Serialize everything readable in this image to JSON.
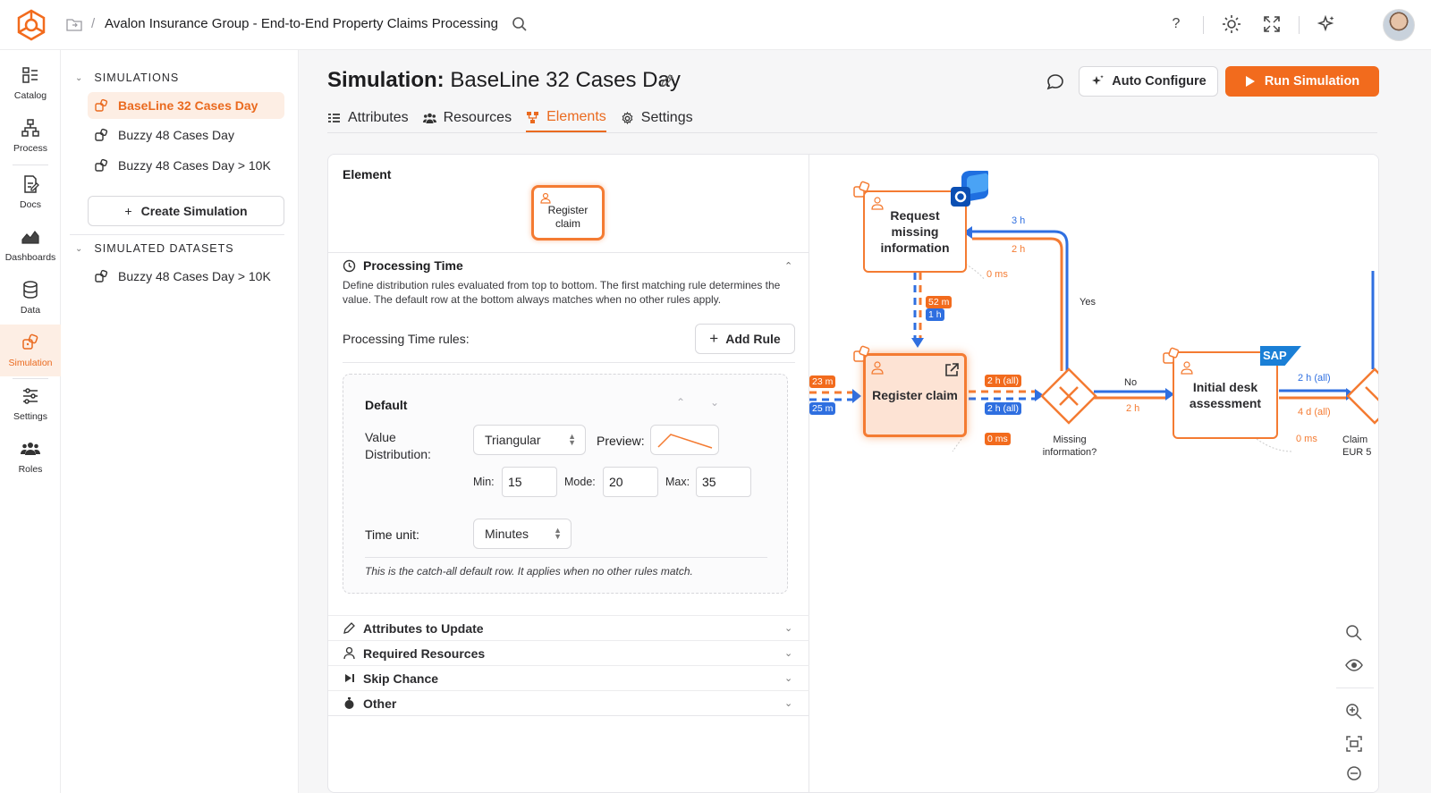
{
  "header": {
    "breadcrumb_sep": "/",
    "title": "Avalon Insurance Group - End-to-End Property Claims Processing",
    "help_glyph": "?"
  },
  "nav": [
    {
      "label": "Catalog",
      "icon": "catalog-icon"
    },
    {
      "label": "Process",
      "icon": "process-icon"
    },
    {
      "label": "Docs",
      "icon": "docs-icon"
    },
    {
      "label": "Dashboards",
      "icon": "dashboards-icon"
    },
    {
      "label": "Data",
      "icon": "data-icon"
    },
    {
      "label": "Simulation",
      "icon": "simulation-icon"
    },
    {
      "label": "Settings",
      "icon": "settings-icon"
    },
    {
      "label": "Roles",
      "icon": "roles-icon"
    }
  ],
  "simulations": {
    "heading": "SIMULATIONS",
    "items": [
      "BaseLine 32 Cases Day",
      "Buzzy 48 Cases Day",
      "Buzzy 48 Cases Day > 10K"
    ],
    "create_label": "Create Simulation",
    "datasets_heading": "SIMULATED DATASETS",
    "datasets": [
      "Buzzy 48 Cases Day > 10K"
    ]
  },
  "main": {
    "title_prefix": "Simulation:",
    "title_name": "BaseLine 32 Cases Day",
    "tabs": [
      "Attributes",
      "Resources",
      "Elements",
      "Settings"
    ],
    "auto_configure": "Auto Configure",
    "run_simulation": "Run Simulation"
  },
  "element": {
    "label": "Element",
    "node_name": "Register claim",
    "processing_time": "Processing Time",
    "description": "Define distribution rules evaluated from top to bottom. The first matching rule determines the value. The default row at the bottom always matches when no other rules apply.",
    "rules_label": "Processing Time rules:",
    "add_rule": "Add Rule",
    "default_title": "Default",
    "value_distribution_label": "Value Distribution:",
    "distribution": "Triangular",
    "preview_label": "Preview:",
    "min_label": "Min:",
    "min": "15",
    "mode_label": "Mode:",
    "mode": "20",
    "max_label": "Max:",
    "max": "35",
    "time_unit_label": "Time unit:",
    "time_unit": "Minutes",
    "note": "This is the catch-all default row. It applies when no other rules match.",
    "sections": [
      "Attributes to Update",
      "Required Resources",
      "Skip Chance",
      "Other"
    ]
  },
  "diagram": {
    "nodes": {
      "request_missing": "Request missing information",
      "register_claim": "Register claim",
      "initial_desk": "Initial desk assessment",
      "missing_info": "Missing information?",
      "claim_eur": "Claim EUR 5"
    },
    "labels": {
      "yes": "Yes",
      "no": "No",
      "t_3h": "3 h",
      "t_2h_top": "2 h",
      "t_0ms_top": "0 ms",
      "t_52m": "52 m",
      "t_1h": "1 h",
      "t_23m": "23 m",
      "t_25m": "25 m",
      "t_2h_all_o": "2 h (all)",
      "t_2h_all_b": "2 h (all)",
      "t_0ms_reg": "0 ms",
      "t_2h_no": "2 h",
      "t_2h_all_r": "2 h (all)",
      "t_4d_all": "4 d (all)",
      "t_0ms_right": "0 ms",
      "sap": "SAP"
    },
    "colors": {
      "orange": "#f47b32",
      "blue": "#2f6fe0"
    }
  }
}
